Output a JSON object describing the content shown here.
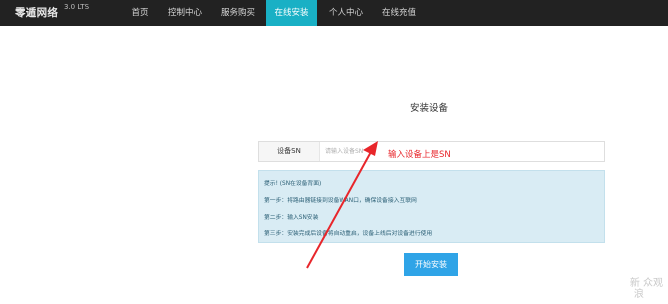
{
  "navbar": {
    "brand": "零遁网络",
    "version": "3.0 LTS",
    "items": [
      {
        "label": "首页"
      },
      {
        "label": "控制中心"
      },
      {
        "label": "服务购买"
      },
      {
        "label": "在线安装",
        "active": true
      },
      {
        "label": "个人中心"
      },
      {
        "label": "在线充值"
      }
    ],
    "background_color": "#222222",
    "active_color": "#19b0c5"
  },
  "main": {
    "title": "安装设备",
    "sn_field": {
      "label": "设备SN",
      "placeholder": "请输入设备SN",
      "value": ""
    },
    "annotation": "输入设备上是SN",
    "annotation_color": "#e8262b",
    "tips": {
      "heading": "提示!  (SN在设备背面)",
      "steps": [
        "第一步：将路由器链接到设备WAN口，确保设备接入互联网",
        "第二步：输入SN安装",
        "第三步：安装完成后设备将自动重启，设备上线后对设备进行使用"
      ],
      "background_color": "#d9ecf4"
    },
    "start_button": "开始安装",
    "button_color": "#2fa4e7"
  },
  "watermark": {
    "line1": "新 众观",
    "line2": "浪"
  }
}
